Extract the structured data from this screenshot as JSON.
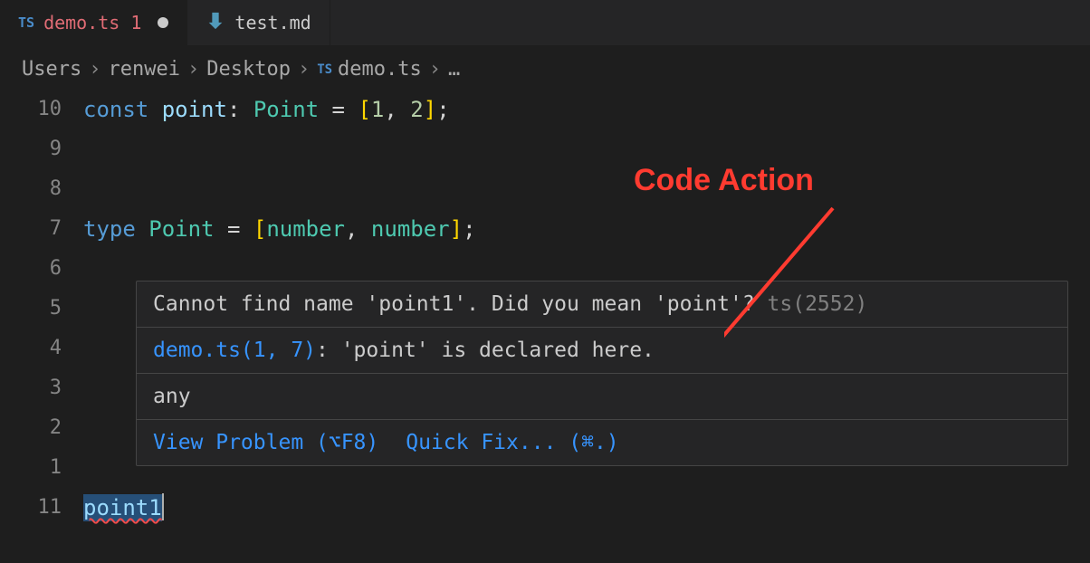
{
  "tabs": [
    {
      "icon": "TS",
      "name": "demo.ts",
      "problems": "1",
      "dirty": true,
      "active": true
    },
    {
      "icon": "markdown",
      "name": "test.md",
      "active": false
    }
  ],
  "breadcrumb": {
    "parts": [
      "Users",
      "renwei",
      "Desktop"
    ],
    "fileIcon": "TS",
    "fileName": "demo.ts",
    "trailing": "…"
  },
  "lines": [
    {
      "num": "10",
      "tokens": [
        {
          "cls": "kw-const",
          "t": "const"
        },
        {
          "cls": "punct",
          "t": " "
        },
        {
          "cls": "identifier",
          "t": "point"
        },
        {
          "cls": "punct",
          "t": ": "
        },
        {
          "cls": "type-name",
          "t": "Point"
        },
        {
          "cls": "punct",
          "t": " = "
        },
        {
          "cls": "bracket",
          "t": "["
        },
        {
          "cls": "number",
          "t": "1"
        },
        {
          "cls": "punct",
          "t": ", "
        },
        {
          "cls": "number",
          "t": "2"
        },
        {
          "cls": "bracket",
          "t": "]"
        },
        {
          "cls": "punct",
          "t": ";"
        }
      ]
    },
    {
      "num": "9",
      "tokens": []
    },
    {
      "num": "8",
      "tokens": []
    },
    {
      "num": "7",
      "tokens": [
        {
          "cls": "kw-type",
          "t": "type"
        },
        {
          "cls": "punct",
          "t": " "
        },
        {
          "cls": "type-name",
          "t": "Point"
        },
        {
          "cls": "punct",
          "t": " = "
        },
        {
          "cls": "bracket",
          "t": "["
        },
        {
          "cls": "kw-number",
          "t": "number"
        },
        {
          "cls": "punct",
          "t": ", "
        },
        {
          "cls": "kw-number",
          "t": "number"
        },
        {
          "cls": "bracket",
          "t": "]"
        },
        {
          "cls": "punct",
          "t": ";"
        }
      ]
    },
    {
      "num": "6",
      "tokens": []
    },
    {
      "num": "5",
      "tokens": []
    },
    {
      "num": "4",
      "tokens": []
    },
    {
      "num": "3",
      "tokens": []
    },
    {
      "num": "2",
      "tokens": []
    },
    {
      "num": "1",
      "tokens": []
    },
    {
      "num": "11",
      "tokens": [
        {
          "cls": "identifier error-squiggle selected-bg",
          "t": "point1"
        }
      ],
      "cursor": true
    }
  ],
  "tooltip": {
    "errorMessage": "Cannot find name 'point1'. Did you mean 'point'?",
    "errorCode": "ts(2552)",
    "declaredFile": "demo.ts(1, 7)",
    "declaredText": ": 'point' is declared here.",
    "typeInfo": "any",
    "actions": {
      "viewProblem": "View Problem (⌥F8)",
      "quickFix": "Quick Fix... (⌘.)"
    }
  },
  "annotation": {
    "text": "Code Action"
  }
}
